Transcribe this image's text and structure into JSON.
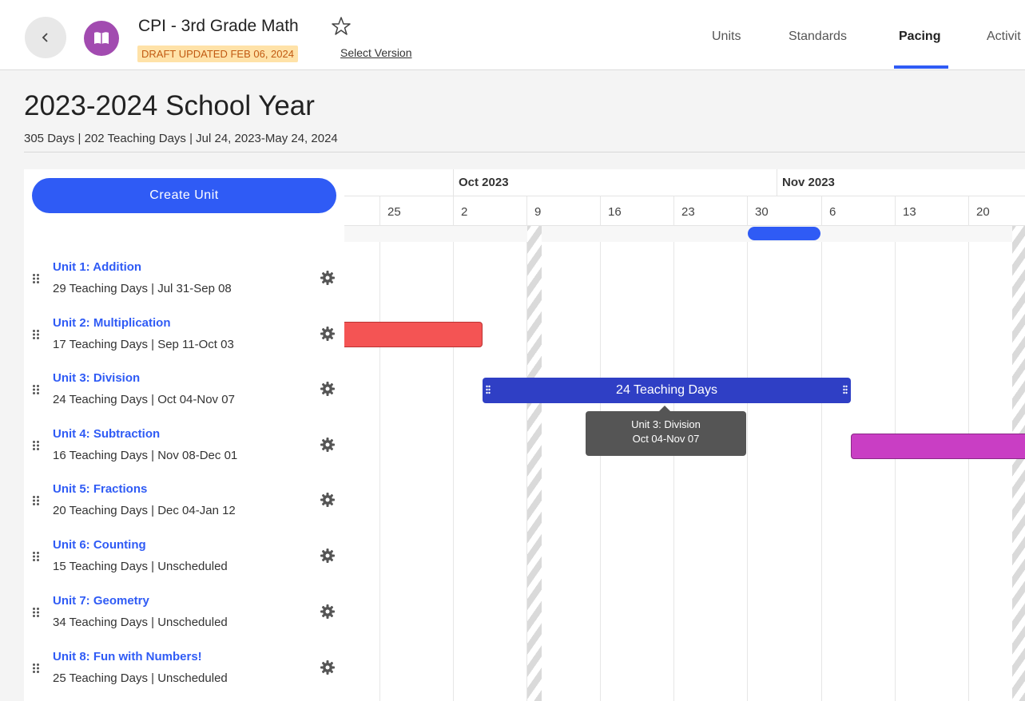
{
  "header": {
    "course_title": "CPI - 3rd Grade Math",
    "draft_badge": "DRAFT UPDATED FEB 06, 2024",
    "select_version": "Select Version",
    "tabs": [
      {
        "label": "Units",
        "active": false
      },
      {
        "label": "Standards",
        "active": false
      },
      {
        "label": "Pacing",
        "active": true
      },
      {
        "label": "Activit",
        "active": false
      }
    ]
  },
  "page": {
    "title": "2023-2024 School Year",
    "meta": "305 Days | 202 Teaching Days | Jul 24, 2023-May 24, 2024"
  },
  "sidebar": {
    "create_button": "Create Unit",
    "units": [
      {
        "name": "Unit 1: Addition",
        "meta": "29 Teaching Days | Jul 31-Sep 08"
      },
      {
        "name": "Unit 2: Multiplication",
        "meta": "17 Teaching Days | Sep 11-Oct 03"
      },
      {
        "name": "Unit 3: Division",
        "meta": "24 Teaching Days | Oct 04-Nov 07"
      },
      {
        "name": "Unit 4: Subtraction",
        "meta": "16 Teaching Days | Nov 08-Dec 01"
      },
      {
        "name": "Unit 5: Fractions",
        "meta": "20 Teaching Days | Dec 04-Jan 12"
      },
      {
        "name": "Unit 6: Counting",
        "meta": "15 Teaching Days | Unscheduled"
      },
      {
        "name": "Unit 7: Geometry",
        "meta": "34 Teaching Days | Unscheduled"
      },
      {
        "name": "Unit 8: Fun with Numbers!",
        "meta": "25 Teaching Days | Unscheduled"
      }
    ]
  },
  "timeline": {
    "months": [
      "Oct 2023",
      "Nov 2023"
    ],
    "weeks": [
      "25",
      "2",
      "9",
      "16",
      "23",
      "30",
      "6",
      "13",
      "20"
    ],
    "unit3_bar_label": "24 Teaching Days",
    "tooltip": {
      "title": "Unit 3: Division",
      "dates": "Oct 04-Nov 07"
    }
  },
  "colors": {
    "accent": "#2f5bf5",
    "unit2_bar": "#f45454",
    "unit3_bar": "#2f3fc5",
    "unit4_bar": "#c93ec4",
    "today_marker": "#2f5bf5"
  }
}
